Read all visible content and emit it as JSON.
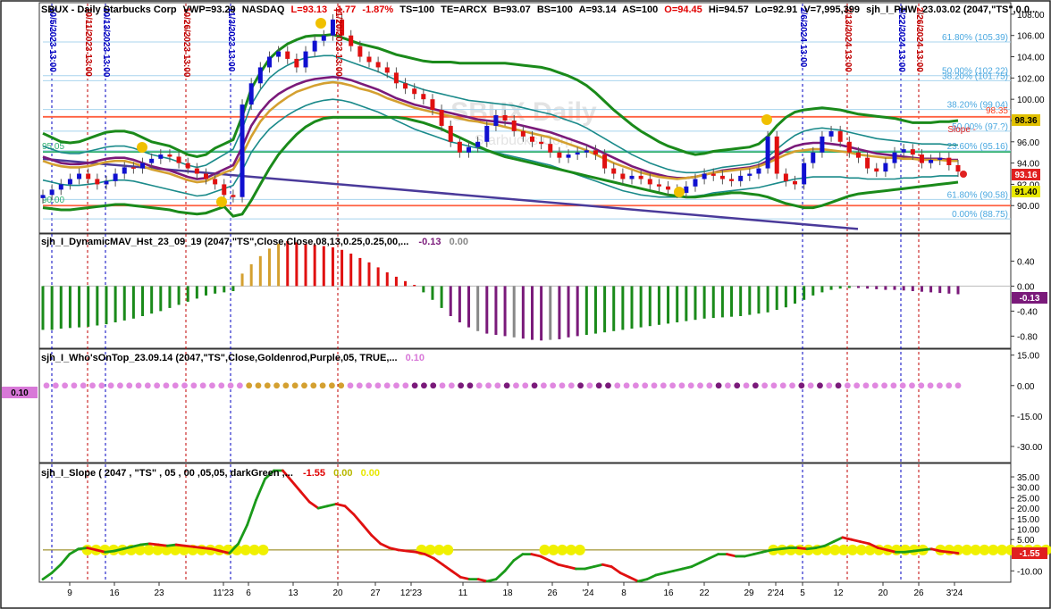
{
  "chart_data": {
    "type": "line",
    "header": {
      "symbol": "SBUX - Daily  Starbucks Corp",
      "vwp": "VWP=93.29",
      "exchange": "NASDAQ",
      "last": "L=93.13",
      "change": "-1.77",
      "change_pct": "-1.87%",
      "ts": "TS=100",
      "te": "TE=ARCX",
      "bid": "B=93.07",
      "bid_size": "BS=100",
      "ask": "A=93.14",
      "ask_size": "AS=100",
      "open": "O=94.45",
      "high": "Hi=94.57",
      "low": "Lo=92.91",
      "volume": "V=7,995,399",
      "study": "sjh_I_PHW_23.03.02 (2047,\"TS\",0.0..."
    },
    "watermark": {
      "title": "SBUX Daily",
      "subtitle": "Starbucks Corp"
    },
    "x_axis": {
      "labels": [
        "9",
        "16",
        "23",
        "11'23",
        "6",
        "13",
        "20",
        "27",
        "12'23",
        "11",
        "18",
        "26",
        "'24",
        "8",
        "16",
        "22",
        "29",
        "2'24",
        "5",
        "12",
        "20",
        "26",
        "3'24"
      ]
    },
    "price_panel": {
      "ylim": [
        87.5,
        109.0
      ],
      "ticks": [
        "108.00",
        "106.00",
        "104.00",
        "102.00",
        "100.00",
        "98.00",
        "96.00",
        "94.00",
        "92.00",
        "90.00"
      ],
      "dates": [
        "10/5/2023 13:00",
        "10/11/2023 13:00",
        "10/13/2023 13:00",
        "10/26/2023 13:00",
        "11/3/2023 13:00",
        "11/20/2023 13:00",
        "2/6/2024 13:00",
        "2/13/2024 13:00",
        "2/22/2024 13:00",
        "2/26/2024 13:00"
      ],
      "fib_labels": [
        "61.80% (105.39)",
        "50.00% (102.22)",
        "38.20% (101.75)",
        "38.20% (99.04)",
        "50.00% (97.?)",
        "23.60% (95.16)",
        "61.80% (90.58)",
        "0.00% (88.75)"
      ],
      "fib_levels": [
        105.39,
        102.22,
        101.75,
        99.04,
        97.0,
        95.16,
        90.58,
        88.75
      ],
      "level_labels": [
        "98.35",
        "95.05",
        "90.00",
        "Slope -"
      ],
      "h_levels": [
        98.35,
        95.05,
        90.0
      ],
      "badges": [
        "98.36",
        "93.16",
        "91.40"
      ],
      "close": [
        91.0,
        91.5,
        92.0,
        92.5,
        93.0,
        92.5,
        92.0,
        92.3,
        93.0,
        93.6,
        93.5,
        94.0,
        94.4,
        94.8,
        94.6,
        94.0,
        93.5,
        93.0,
        92.5,
        92.0,
        91.0,
        90.8,
        99.5,
        101.5,
        103.0,
        104.0,
        104.5,
        103.8,
        103.0,
        104.5,
        105.5,
        106.0,
        107.5,
        106.0,
        105.0,
        104.0,
        103.5,
        103.0,
        102.5,
        101.5,
        101.0,
        100.5,
        100.0,
        99.0,
        97.5,
        96.0,
        95.0,
        95.5,
        96.0,
        97.5,
        98.5,
        98.0,
        97.0,
        96.5,
        96.0,
        95.8,
        95.0,
        94.5,
        94.8,
        95.0,
        95.2,
        94.8,
        93.5,
        93.0,
        92.5,
        92.8,
        92.5,
        92.0,
        91.8,
        91.5,
        91.2,
        91.8,
        92.5,
        93.0,
        92.8,
        92.5,
        92.3,
        92.8,
        93.0,
        93.5,
        96.5,
        93.0,
        92.3,
        92.0,
        94.0,
        95.0,
        96.5,
        97.0,
        96.0,
        95.0,
        94.5,
        93.5,
        93.2,
        94.0,
        95.0,
        95.3,
        94.8,
        94.0,
        94.3,
        94.5,
        93.8,
        93.2
      ],
      "series": [
        {
          "name": "",
          "color": "#1a8a1a",
          "values": [
            96.8,
            96.4,
            96.0,
            95.9,
            96.0,
            96.3,
            96.6,
            96.9,
            97.0,
            97.0,
            96.8,
            96.4,
            96.0,
            95.8,
            95.6,
            95.2,
            94.8,
            94.6,
            94.8,
            95.4,
            95.8,
            96.2,
            98.4,
            101.0,
            102.5,
            103.8,
            104.6,
            105.2,
            105.6,
            105.9,
            106.0,
            106.0,
            106.1,
            105.8,
            105.5,
            105.2,
            105.0,
            104.8,
            104.5,
            104.2,
            104.0,
            103.8,
            103.6,
            103.5,
            103.5,
            103.5,
            103.4,
            103.4,
            103.4,
            103.4,
            103.4,
            103.4,
            103.3,
            103.2,
            103.1,
            103.0,
            102.8,
            102.5,
            102.2,
            101.8,
            101.3,
            100.6,
            99.8,
            99.0,
            98.3,
            97.6,
            97.0,
            96.5,
            96.0,
            95.6,
            95.3,
            95.0,
            94.8,
            94.9,
            95.1,
            95.2,
            95.3,
            95.4,
            95.5,
            95.8,
            96.5,
            97.5,
            98.3,
            98.8,
            99.0,
            99.1,
            99.2,
            99.1,
            99.0,
            98.8,
            98.6,
            98.5,
            98.4,
            98.3,
            98.2,
            98.0,
            97.8,
            97.8,
            97.8,
            97.9,
            97.9,
            98.0
          ]
        },
        {
          "name": "",
          "color": "#1a8a8a",
          "values": [
            95.6,
            95.3,
            95.0,
            94.9,
            94.9,
            95.1,
            95.3,
            95.5,
            95.6,
            95.6,
            95.4,
            95.1,
            94.8,
            94.6,
            94.4,
            94.1,
            93.8,
            93.6,
            93.8,
            94.3,
            94.8,
            95.3,
            97.2,
            99.5,
            100.9,
            102.0,
            102.7,
            103.2,
            103.6,
            103.9,
            104.0,
            104.1,
            104.1,
            103.8,
            103.5,
            103.2,
            102.9,
            102.6,
            102.2,
            101.8,
            101.5,
            101.2,
            100.9,
            100.7,
            100.5,
            100.3,
            100.1,
            99.9,
            99.8,
            99.7,
            99.6,
            99.5,
            99.4,
            99.2,
            99.0,
            98.8,
            98.6,
            98.3,
            98.0,
            97.7,
            97.3,
            96.8,
            96.3,
            95.8,
            95.3,
            94.8,
            94.4,
            94.0,
            93.7,
            93.4,
            93.2,
            93.1,
            93.1,
            93.2,
            93.4,
            93.6,
            93.7,
            93.8,
            93.9,
            94.1,
            94.6,
            95.3,
            96.0,
            96.6,
            97.0,
            97.2,
            97.3,
            97.2,
            97.1,
            96.9,
            96.7,
            96.5,
            96.3,
            96.2,
            96.1,
            96.0,
            95.9,
            95.8,
            95.8,
            95.8,
            95.7,
            95.7
          ]
        },
        {
          "name": "",
          "color": "#7a1a7a",
          "values": [
            94.6,
            94.3,
            94.0,
            93.9,
            93.9,
            94.0,
            94.2,
            94.4,
            94.5,
            94.5,
            94.3,
            94.0,
            93.7,
            93.5,
            93.3,
            93.0,
            92.7,
            92.5,
            92.6,
            93.0,
            93.4,
            93.8,
            95.5,
            97.5,
            98.8,
            99.8,
            100.5,
            101.0,
            101.4,
            101.7,
            101.9,
            102.0,
            102.1,
            102.0,
            101.8,
            101.5,
            101.2,
            100.9,
            100.5,
            100.1,
            99.8,
            99.5,
            99.3,
            99.1,
            98.9,
            98.7,
            98.5,
            98.3,
            98.1,
            98.0,
            97.9,
            97.8,
            97.7,
            97.5,
            97.3,
            97.1,
            96.9,
            96.6,
            96.3,
            96.0,
            95.7,
            95.3,
            94.9,
            94.5,
            94.1,
            93.7,
            93.4,
            93.1,
            92.9,
            92.7,
            92.6,
            92.6,
            92.7,
            92.9,
            93.1,
            93.3,
            93.4,
            93.5,
            93.6,
            93.8,
            94.2,
            94.7,
            95.2,
            95.6,
            95.8,
            95.9,
            95.9,
            95.8,
            95.7,
            95.5,
            95.3,
            95.1,
            94.9,
            94.8,
            94.7,
            94.6,
            94.5,
            94.4,
            94.4,
            94.4,
            94.3,
            94.3
          ]
        },
        {
          "name": "",
          "color": "#d4a030",
          "values": [
            94.2,
            93.9,
            93.7,
            93.6,
            93.6,
            93.7,
            93.9,
            94.1,
            94.2,
            94.2,
            94.0,
            93.7,
            93.4,
            93.2,
            93.0,
            92.7,
            92.4,
            92.2,
            92.3,
            92.7,
            93.1,
            93.4,
            94.8,
            96.5,
            97.9,
            98.9,
            99.6,
            100.2,
            100.7,
            101.0,
            101.3,
            101.5,
            101.6,
            101.5,
            101.3,
            101.0,
            100.8,
            100.5,
            100.1,
            99.8,
            99.5,
            99.2,
            99.0,
            98.8,
            98.6,
            98.4,
            98.2,
            98.0,
            97.9,
            97.7,
            97.6,
            97.4,
            97.2,
            97.0,
            96.8,
            96.6,
            96.4,
            96.1,
            95.8,
            95.5,
            95.2,
            94.8,
            94.4,
            94.0,
            93.7,
            93.4,
            93.1,
            92.9,
            92.7,
            92.6,
            92.5,
            92.6,
            92.7,
            92.9,
            93.1,
            93.2,
            93.3,
            93.4,
            93.5,
            93.7,
            94.0,
            94.4,
            94.8,
            95.1,
            95.2,
            95.3,
            95.3,
            95.2,
            95.1,
            95.0,
            94.8,
            94.7,
            94.6,
            94.5,
            94.5,
            94.4,
            94.4,
            94.3,
            94.3,
            94.3,
            94.2,
            94.2
          ]
        },
        {
          "name": "",
          "color": "#1a8a8a",
          "values": [
            92.4,
            92.2,
            92.0,
            91.9,
            91.9,
            92.0,
            92.1,
            92.3,
            92.4,
            92.4,
            92.3,
            92.1,
            91.9,
            91.7,
            91.5,
            91.3,
            91.1,
            90.9,
            91.0,
            91.3,
            91.6,
            91.9,
            93.3,
            95.0,
            96.2,
            97.2,
            97.9,
            98.5,
            99.0,
            99.4,
            99.7,
            99.9,
            100.0,
            99.9,
            99.7,
            99.4,
            99.1,
            98.8,
            98.4,
            98.0,
            97.6,
            97.2,
            96.9,
            96.6,
            96.3,
            96.0,
            95.8,
            95.6,
            95.4,
            95.2,
            95.0,
            94.8,
            94.6,
            94.4,
            94.2,
            94.0,
            93.8,
            93.5,
            93.2,
            92.9,
            92.6,
            92.3,
            92.0,
            91.7,
            91.4,
            91.2,
            91.0,
            90.9,
            90.8,
            90.8,
            90.8,
            90.8,
            90.9,
            91.0,
            91.2,
            91.3,
            91.4,
            91.5,
            91.6,
            91.7,
            91.9,
            92.1,
            92.3,
            92.5,
            92.6,
            92.7,
            92.7,
            92.7,
            92.7,
            92.6,
            92.6,
            92.5,
            92.5,
            92.5,
            92.5,
            92.6,
            92.6,
            92.7,
            92.7,
            92.8,
            92.8,
            92.8
          ]
        },
        {
          "name": "",
          "color": "#1a8a1a",
          "values": [
            89.8,
            89.7,
            89.6,
            89.6,
            89.7,
            89.8,
            89.9,
            90.0,
            90.1,
            90.1,
            90.0,
            89.9,
            89.8,
            89.7,
            89.6,
            89.4,
            89.3,
            89.2,
            89.3,
            89.6,
            89.9,
            89.0,
            89.2,
            90.5,
            92.0,
            93.5,
            94.8,
            95.8,
            96.7,
            97.4,
            97.9,
            98.2,
            98.3,
            98.3,
            98.3,
            98.3,
            98.3,
            98.3,
            98.3,
            98.3,
            98.2,
            98.0,
            97.8,
            97.5,
            97.2,
            96.8,
            96.4,
            96.0,
            95.6,
            95.2,
            94.9,
            94.6,
            94.4,
            94.2,
            94.0,
            93.8,
            93.6,
            93.4,
            93.2,
            93.0,
            92.8,
            92.6,
            92.4,
            92.2,
            92.0,
            91.8,
            91.6,
            91.4,
            91.2,
            91.0,
            90.9,
            90.8,
            90.8,
            90.9,
            91.0,
            91.1,
            91.2,
            91.2,
            91.1,
            91.0,
            90.8,
            90.5,
            90.2,
            90.0,
            89.8,
            89.8,
            90.0,
            90.3,
            90.6,
            90.9,
            91.1,
            91.2,
            91.3,
            91.4,
            91.5,
            91.6,
            91.7,
            91.8,
            91.9,
            92.0,
            92.1,
            92.2
          ]
        }
      ]
    },
    "panel1": {
      "title": "sjh_I_DynamicMAV_Hst_23_09_19 (2047,\"TS\",Close,Close,08,13,0.25,0.25,00,...",
      "value1": "-0.13",
      "value2": "0.00",
      "badge": "-0.13",
      "ylim": [
        -0.98,
        0.82
      ],
      "ticks": [
        "0.40",
        "0.00",
        "-0.40",
        "-0.80"
      ],
      "values": [
        -0.7,
        -0.7,
        -0.68,
        -0.67,
        -0.66,
        -0.65,
        -0.63,
        -0.61,
        -0.58,
        -0.55,
        -0.52,
        -0.48,
        -0.44,
        -0.4,
        -0.35,
        -0.3,
        -0.25,
        -0.2,
        -0.15,
        -0.12,
        -0.1,
        -0.08,
        0.2,
        0.35,
        0.48,
        0.6,
        0.68,
        0.72,
        0.7,
        0.68,
        0.66,
        0.64,
        0.62,
        0.58,
        0.52,
        0.45,
        0.38,
        0.3,
        0.22,
        0.15,
        0.08,
        0.02,
        -0.1,
        -0.22,
        -0.35,
        -0.48,
        -0.58,
        -0.66,
        -0.72,
        -0.76,
        -0.78,
        -0.8,
        -0.82,
        -0.84,
        -0.86,
        -0.87,
        -0.86,
        -0.85,
        -0.82,
        -0.8,
        -0.78,
        -0.76,
        -0.74,
        -0.72,
        -0.7,
        -0.68,
        -0.66,
        -0.64,
        -0.62,
        -0.6,
        -0.58,
        -0.56,
        -0.54,
        -0.52,
        -0.51,
        -0.5,
        -0.49,
        -0.48,
        -0.46,
        -0.44,
        -0.42,
        -0.38,
        -0.34,
        -0.28,
        -0.22,
        -0.15,
        -0.1,
        -0.06,
        -0.04,
        -0.03,
        -0.03,
        -0.04,
        -0.05,
        -0.06,
        -0.06,
        -0.07,
        -0.08,
        -0.09,
        -0.1,
        -0.11,
        -0.12,
        -0.13
      ]
    },
    "panel2": {
      "title": "sjh_I_Who'sOnTop_23.09.14 (2047,\"TS\",Close,Goldenrod,Purple,05,  TRUE,...",
      "value": "0.10",
      "badge": "0.10",
      "ylim": [
        -37.5,
        17.5
      ],
      "ticks": [
        "15.00",
        "0.00",
        "-15.00",
        "-30.00"
      ]
    },
    "panel3": {
      "title": "sjh_I_Slope ( 2047 , \"TS\" , 05 , 00 ,05,05, darkGreen ,...",
      "value1": "-1.55",
      "value2": "0.00",
      "value3": "0.00",
      "badge": "-1.55",
      "ylim": [
        -15,
        41
      ],
      "ticks": [
        "35.00",
        "30.00",
        "25.00",
        "20.00",
        "15.00",
        "10.00",
        "5.00",
        "-10.00"
      ],
      "values": [
        -14,
        -11,
        -7,
        -2,
        0.5,
        1,
        0,
        -1,
        -0.5,
        0.5,
        1.5,
        2.5,
        3,
        2.5,
        2,
        2.5,
        2,
        1.5,
        1,
        0.5,
        -0.5,
        -1.5,
        3,
        12,
        24,
        34,
        38,
        38,
        33,
        28,
        23,
        20,
        21,
        22,
        21,
        17,
        12,
        7,
        3,
        1,
        0,
        -0.5,
        -1,
        -2,
        -4,
        -7,
        -10,
        -13,
        -14,
        -14,
        -15,
        -14,
        -10,
        -5,
        -2,
        -2,
        -3,
        -5,
        -7,
        -8,
        -9,
        -9,
        -8,
        -7,
        -8,
        -11,
        -13,
        -15,
        -14,
        -12,
        -11,
        -10,
        -9,
        -8,
        -6,
        -4,
        -2,
        -2,
        -3,
        -3,
        -2,
        -1,
        0,
        0.5,
        1,
        1,
        0.5,
        1,
        2,
        4,
        6,
        5,
        4,
        3,
        1,
        0,
        -1,
        -1,
        -0.5,
        0,
        0.5,
        -0.5,
        -1,
        -1.55
      ],
      "dot_ranges": [
        [
          2,
          22
        ],
        [
          40,
          43
        ],
        [
          54,
          58
        ],
        [
          80,
          97
        ],
        [
          99,
          112
        ]
      ]
    }
  }
}
